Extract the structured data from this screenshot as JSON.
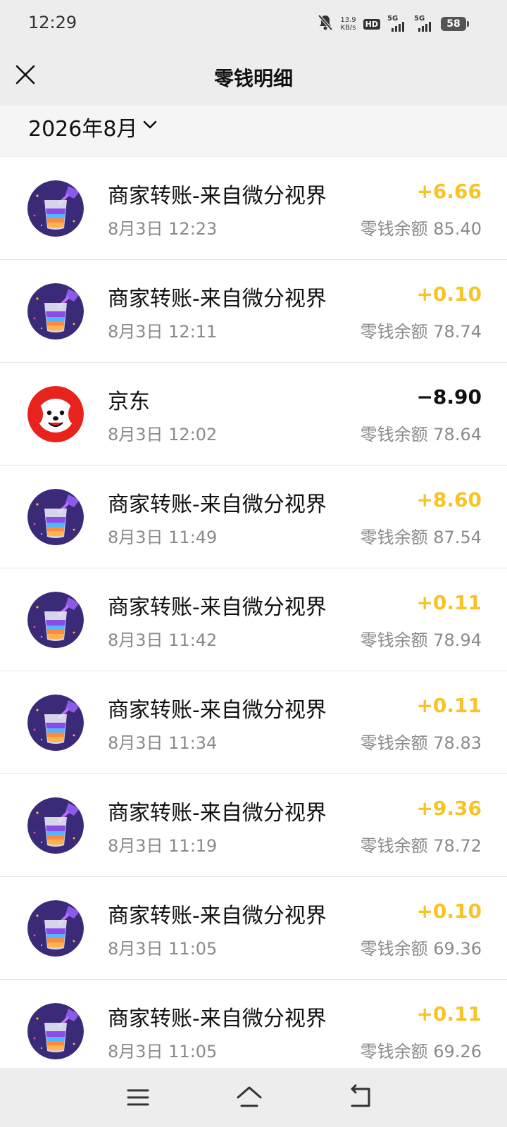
{
  "status_bar": {
    "time": "12:29",
    "net_speed_value": "13.9",
    "net_speed_unit": "KB/s",
    "hd_label": "HD",
    "signal_1_label": "5G",
    "signal_2_label": "5G",
    "battery": "58",
    "icons": [
      "mute-bell-icon",
      "hd-icon",
      "signal-icon",
      "battery-icon"
    ]
  },
  "header": {
    "title": "零钱明细",
    "close_icon": "close-icon"
  },
  "filter": {
    "month_label": "2026年8月",
    "chevron_icon": "chevron-down-icon"
  },
  "colors": {
    "positive_amount": "#f7c325",
    "negative_amount": "#111111",
    "background": "#ededed"
  },
  "transactions": [
    {
      "avatar": "weifen-cup",
      "title": "商家转账-来自微分视界",
      "time": "8月3日 12:23",
      "amount": "+6.66",
      "balance": "零钱余额 85.40"
    },
    {
      "avatar": "weifen-cup",
      "title": "商家转账-来自微分视界",
      "time": "8月3日 12:11",
      "amount": "+0.10",
      "balance": "零钱余额 78.74"
    },
    {
      "avatar": "jd-dog",
      "title": "京东",
      "time": "8月3日 12:02",
      "amount": "−8.90",
      "balance": "零钱余额 78.64"
    },
    {
      "avatar": "weifen-cup",
      "title": "商家转账-来自微分视界",
      "time": "8月3日 11:49",
      "amount": "+8.60",
      "balance": "零钱余额 87.54"
    },
    {
      "avatar": "weifen-cup",
      "title": "商家转账-来自微分视界",
      "time": "8月3日 11:42",
      "amount": "+0.11",
      "balance": "零钱余额 78.94"
    },
    {
      "avatar": "weifen-cup",
      "title": "商家转账-来自微分视界",
      "time": "8月3日 11:34",
      "amount": "+0.11",
      "balance": "零钱余额 78.83"
    },
    {
      "avatar": "weifen-cup",
      "title": "商家转账-来自微分视界",
      "time": "8月3日 11:19",
      "amount": "+9.36",
      "balance": "零钱余额 78.72"
    },
    {
      "avatar": "weifen-cup",
      "title": "商家转账-来自微分视界",
      "time": "8月3日 11:05",
      "amount": "+0.10",
      "balance": "零钱余额 69.36"
    },
    {
      "avatar": "weifen-cup",
      "title": "商家转账-来自微分视界",
      "time": "8月3日 11:05",
      "amount": "+0.11",
      "balance": "零钱余额 69.26"
    }
  ],
  "nav_bar": {
    "icons": [
      "menu-icon",
      "home-icon",
      "back-icon"
    ]
  }
}
